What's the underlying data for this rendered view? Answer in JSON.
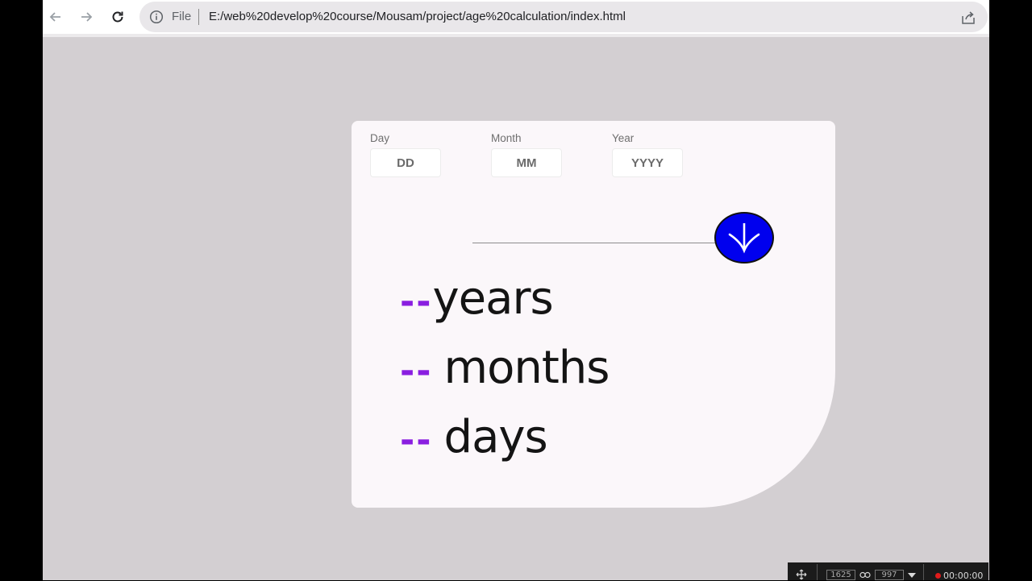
{
  "browser": {
    "scheme_label": "File",
    "url": "E:/web%20develop%20course/Mousam/project/age%20calculation/index.html"
  },
  "form": {
    "day": {
      "label": "Day",
      "placeholder": "DD"
    },
    "month": {
      "label": "Month",
      "placeholder": "MM"
    },
    "year": {
      "label": "Year",
      "placeholder": "YYYY"
    }
  },
  "result": {
    "years": {
      "value": "--",
      "unit": "years"
    },
    "months": {
      "value": "--",
      "unit": "months"
    },
    "days": {
      "value": "--",
      "unit": "days"
    }
  },
  "colors": {
    "accent": "#8a1ee0",
    "button": "#0000ee",
    "page_background": "#d3cfd2",
    "card_background": "#fbf7fa"
  },
  "recorder": {
    "width_value": "1625",
    "height_value": "997",
    "time": "00:00:00"
  }
}
